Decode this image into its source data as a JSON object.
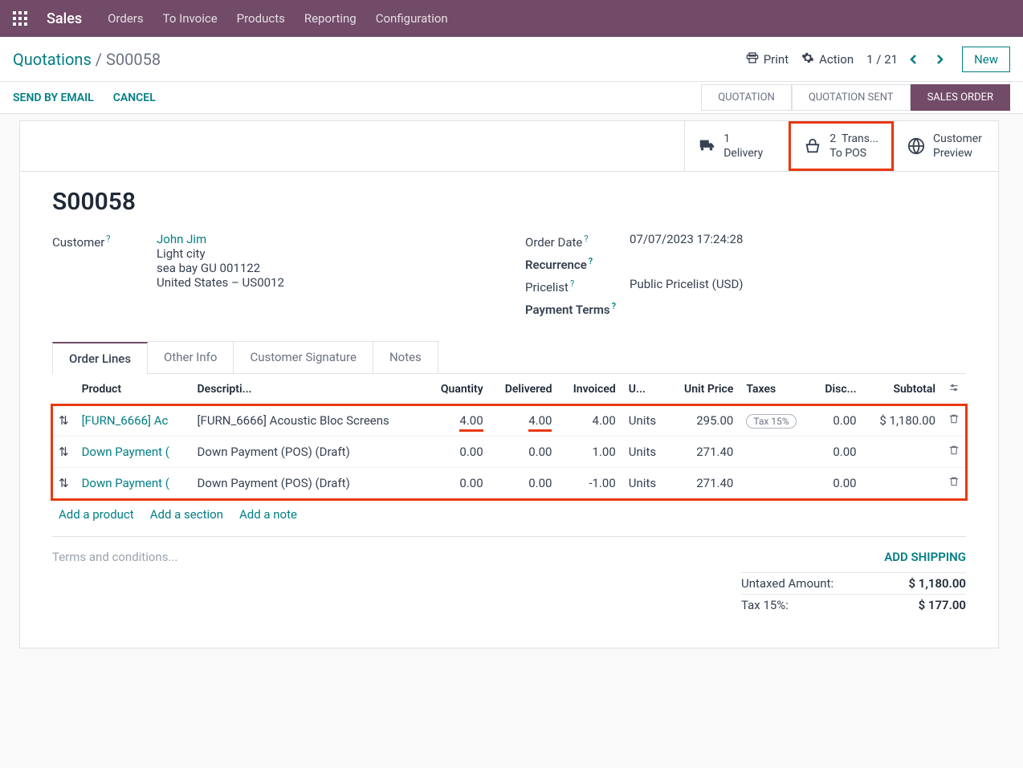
{
  "topbar": {
    "brand": "Sales",
    "nav": [
      "Orders",
      "To Invoice",
      "Products",
      "Reporting",
      "Configuration"
    ]
  },
  "breadcrumb": {
    "root": "Quotations",
    "current": "S00058"
  },
  "controls": {
    "print": "Print",
    "action": "Action",
    "pager": "1 / 21",
    "new": "New"
  },
  "actions": {
    "send_email": "SEND BY EMAIL",
    "cancel": "CANCEL"
  },
  "status": {
    "steps": [
      "QUOTATION",
      "QUOTATION SENT",
      "SALES ORDER"
    ],
    "active": 2
  },
  "stat_buttons": [
    {
      "count": "1",
      "label": "Delivery",
      "icon": "truck"
    },
    {
      "count": "2",
      "label1": "Trans...",
      "label2": "To POS",
      "icon": "basket",
      "highlighted": true
    },
    {
      "count": "",
      "label1": "Customer",
      "label2": "Preview",
      "icon": "globe"
    }
  ],
  "record": {
    "title": "S00058",
    "customer_label": "Customer",
    "customer_name": "John Jim",
    "customer_address": [
      "Light city",
      "sea bay GU 001122",
      "United States – US0012"
    ],
    "order_date_label": "Order Date",
    "order_date": "07/07/2023 17:24:28",
    "recurrence_label": "Recurrence",
    "pricelist_label": "Pricelist",
    "pricelist": "Public Pricelist (USD)",
    "payment_terms_label": "Payment Terms"
  },
  "tabs": [
    "Order Lines",
    "Other Info",
    "Customer Signature",
    "Notes"
  ],
  "table": {
    "headers": {
      "product": "Product",
      "description": "Descripti...",
      "quantity": "Quantity",
      "delivered": "Delivered",
      "invoiced": "Invoiced",
      "uom": "U...",
      "unit_price": "Unit Price",
      "taxes": "Taxes",
      "discount": "Disc...",
      "subtotal": "Subtotal"
    },
    "rows": [
      {
        "product": "[FURN_6666] Ac",
        "description": "[FURN_6666] Acoustic Bloc Screens",
        "quantity": "4.00",
        "delivered": "4.00",
        "invoiced": "4.00",
        "uom": "Units",
        "unit_price": "295.00",
        "tax": "Tax 15%",
        "discount": "0.00",
        "subtotal": "$ 1,180.00",
        "underlined": true
      },
      {
        "product": "Down Payment (",
        "description": "Down Payment (POS) (Draft)",
        "quantity": "0.00",
        "delivered": "0.00",
        "invoiced": "1.00",
        "uom": "Units",
        "unit_price": "271.40",
        "tax": "",
        "discount": "0.00",
        "subtotal": ""
      },
      {
        "product": "Down Payment (",
        "description": "Down Payment (POS) (Draft)",
        "quantity": "0.00",
        "delivered": "0.00",
        "invoiced": "-1.00",
        "uom": "Units",
        "unit_price": "271.40",
        "tax": "",
        "discount": "0.00",
        "subtotal": ""
      }
    ],
    "add_product": "Add a product",
    "add_section": "Add a section",
    "add_note": "Add a note"
  },
  "bottom": {
    "terms_placeholder": "Terms and conditions...",
    "add_shipping": "ADD SHIPPING",
    "untaxed_label": "Untaxed Amount:",
    "untaxed_value": "$ 1,180.00",
    "tax_label": "Tax 15%:",
    "tax_value": "$ 177.00"
  }
}
